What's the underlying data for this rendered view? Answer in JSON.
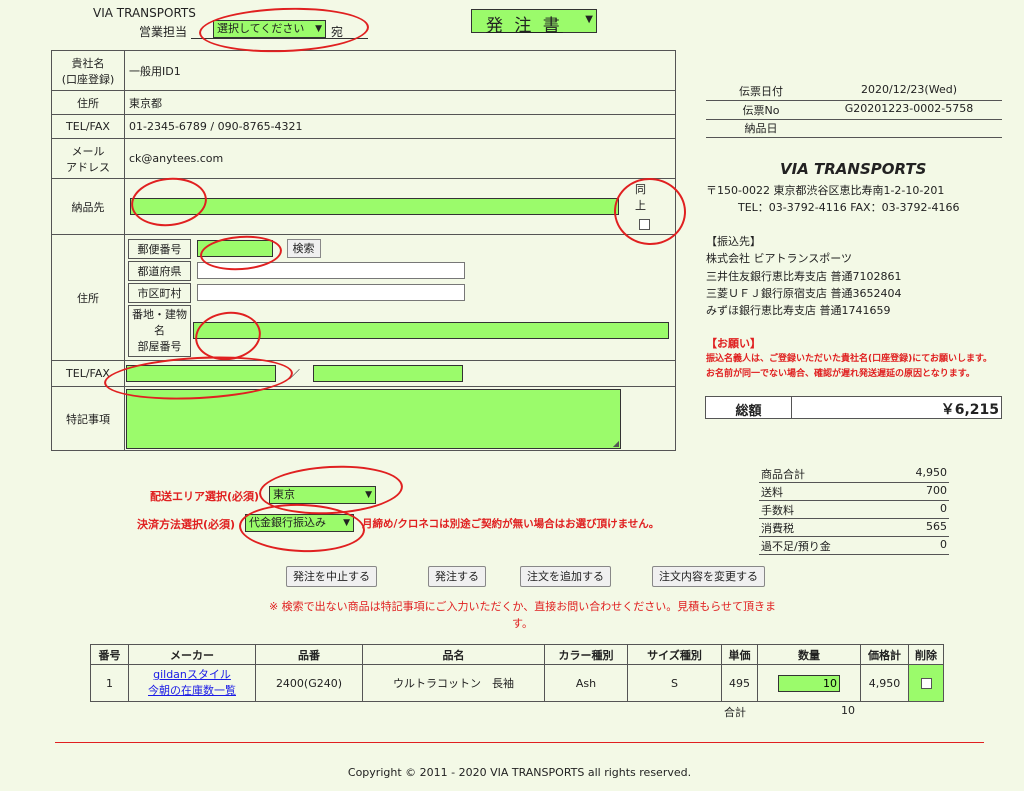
{
  "header": {
    "company": "VIA TRANSPORTS",
    "sales_label": "営業担当",
    "sales_select": "選択してください",
    "suffix": "宛",
    "doc_title": "発 注 書"
  },
  "customer": {
    "rows": {
      "company_name": {
        "label": "貴社名\n(口座登録)",
        "value": "一般用ID1"
      },
      "address": {
        "label": "住所",
        "value": "東京都"
      },
      "telfax": {
        "label": "TEL/FAX",
        "value": "01-2345-6789 / 090-8765-4321"
      },
      "email": {
        "label": "メール\nアドレス",
        "value": "ck@anytees.com"
      }
    },
    "delivery": {
      "label": "納品先",
      "name_value": "",
      "same_label": "同\n上"
    },
    "delivery_address": {
      "label": "住所",
      "postal_label": "郵便番号",
      "search_button": "検索",
      "prefecture_label": "都道府県",
      "city_label": "市区町村",
      "street_label": "番地・建物\n名\n部屋番号"
    },
    "delivery_tel": {
      "label": "TEL/FAX",
      "separator": "／"
    },
    "notes": {
      "label": "特記事項"
    }
  },
  "slip": {
    "date_label": "伝票日付",
    "date_value": "2020/12/23(Wed)",
    "no_label": "伝票No",
    "no_value": "G20201223-0002-5758",
    "delivery_date_label": "納品日",
    "delivery_date_value": ""
  },
  "company_info": {
    "name": "VIA  TRANSPORTS",
    "address": "〒150-0022 東京都渋谷区恵比寿南1-2-10-201",
    "contact": "TEL：03-3792-4116  FAX：03-3792-4166",
    "bank_header": "【振込先】",
    "bank_lines": [
      "株式会社 ビアトランスポーツ",
      "三井住友銀行恵比寿支店 普通7102861",
      "三菱ＵＦＪ銀行原宿支店 普通3652404",
      "みずほ銀行恵比寿支店 普通1741659"
    ],
    "request_header": "【お願い】",
    "request_lines": [
      "振込名義人は、ご登録いただいた貴社名(口座登録)にてお願いします。",
      "お名前が同一でない場合、確認が遅れ発送遅延の原因となります。"
    ]
  },
  "total": {
    "label": "総額",
    "value": "￥6,215"
  },
  "summary": [
    {
      "label": "商品合計",
      "value": "4,950"
    },
    {
      "label": "送料",
      "value": "700"
    },
    {
      "label": "手数料",
      "value": "0"
    },
    {
      "label": "消費税",
      "value": "565"
    },
    {
      "label": "過不足/預り金",
      "value": "0"
    }
  ],
  "shipping": {
    "area_label": "配送エリア選択(必須)",
    "area_value": "東京",
    "payment_label": "決済方法選択(必須)",
    "payment_value": "代金銀行振込み",
    "payment_note": "月締め/クロネコは別途ご契約が無い場合はお選び頂けません。"
  },
  "actions": {
    "cancel": "発注を中止する",
    "order": "発注する",
    "add": "注文を追加する",
    "change": "注文内容を変更する"
  },
  "notice": "※ 検索で出ない商品は特記事項にご入力いただくか、直接お問い合わせください。見積もらせて頂きます。",
  "items_table": {
    "headers": [
      "番号",
      "メーカー",
      "品番",
      "品名",
      "カラー種別",
      "サイズ種別",
      "単価",
      "数量",
      "価格計",
      "削除"
    ],
    "rows": [
      {
        "no": "1",
        "maker_link1": "gildanスタイル",
        "maker_link2": "今朝の在庫数一覧",
        "code": "2400(G240)",
        "name": "ウルトラコットン　長袖",
        "color": "Ash",
        "size": "S",
        "price": "495",
        "qty": "10",
        "subtotal": "4,950"
      }
    ],
    "total_label": "合計",
    "total_qty": "10"
  },
  "footer": {
    "copyright": "Copyright © 2011 - 2020 VIA TRANSPORTS all rights reserved."
  },
  "colors": {
    "field_green": "#9bfb6b",
    "annotation_red": "#e02020",
    "background": "#f3f9e6",
    "warning_red": "#e02020",
    "link_blue": "#1a1ae6"
  }
}
